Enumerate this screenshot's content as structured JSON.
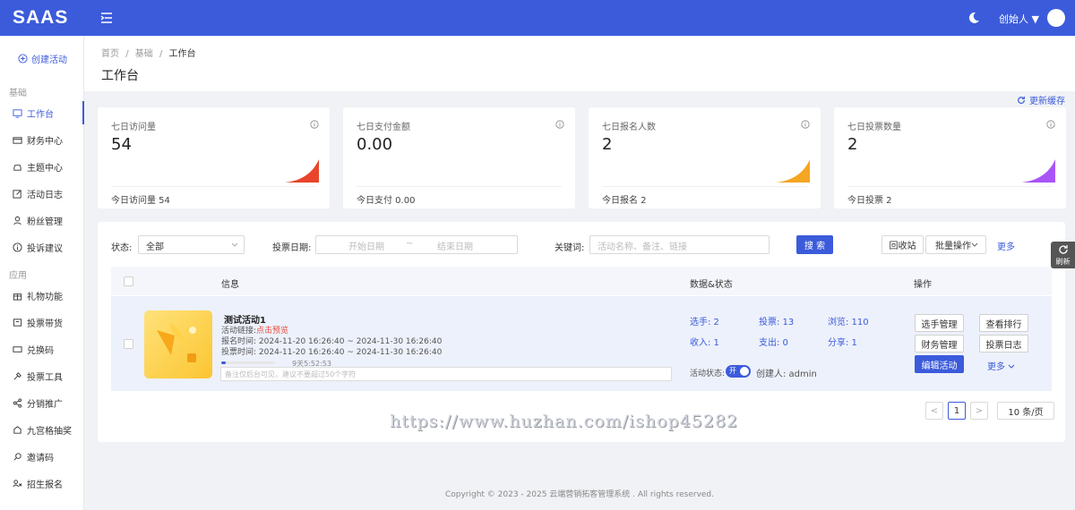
{
  "topbar": {
    "logo": "SAAS",
    "user": "创始人 ▼"
  },
  "sidebar": {
    "create": "创建活动",
    "group_basic": "基础",
    "group_app": "应用",
    "items": [
      {
        "label": "工作台",
        "icon": "monitor-icon"
      },
      {
        "label": "财务中心",
        "icon": "wallet-icon"
      },
      {
        "label": "主题中心",
        "icon": "car-icon"
      },
      {
        "label": "活动日志",
        "icon": "edit-icon"
      },
      {
        "label": "粉丝管理",
        "icon": "user-icon"
      },
      {
        "label": "投诉建议",
        "icon": "info-icon"
      },
      {
        "label": "礼物功能",
        "icon": "gift-icon"
      },
      {
        "label": "投票带货",
        "icon": "cart-icon"
      },
      {
        "label": "兑换码",
        "icon": "ticket-icon"
      },
      {
        "label": "投票工具",
        "icon": "tool-icon"
      },
      {
        "label": "分销推广",
        "icon": "share-icon"
      },
      {
        "label": "九宫格抽奖",
        "icon": "grid-icon"
      },
      {
        "label": "邀请码",
        "icon": "key-icon"
      },
      {
        "label": "招生报名",
        "icon": "people-icon"
      }
    ]
  },
  "breadcrumb": {
    "home": "首页",
    "sep": "/",
    "basic": "基础",
    "current": "工作台"
  },
  "page_title": "工作台",
  "refresh_cache": "更新缓存",
  "cards": [
    {
      "title": "七日访问量",
      "value": "54",
      "footer": "今日访问量 54",
      "color": "#e8452c"
    },
    {
      "title": "七日支付金额",
      "value": "0.00",
      "footer": "今日支付 0.00",
      "color": "#3b5bdb"
    },
    {
      "title": "七日报名人数",
      "value": "2",
      "footer": "今日报名 2",
      "color": "#f5a623"
    },
    {
      "title": "七日投票数量",
      "value": "2",
      "footer": "今日投票 2",
      "color": "#a855f7"
    }
  ],
  "filters": {
    "status_label": "状态:",
    "status_value": "全部",
    "date_label": "投票日期:",
    "start_placeholder": "开始日期",
    "date_sep": "~",
    "end_placeholder": "结束日期",
    "keyword_label": "关键词:",
    "keyword_placeholder": "活动名称、备注、链接",
    "search": "搜 索",
    "recycle": "回收站",
    "batch": "批量操作",
    "more": "更多"
  },
  "table": {
    "col_info": "信息",
    "col_stats": "数据&状态",
    "col_ops": "操作",
    "row": {
      "title": "测试活动1",
      "link_label": "活动链接:",
      "link_text": "点击预览",
      "signup_time": "报名时间: 2024-11-20 16:26:40 ~ 2024-11-30 16:26:40",
      "vote_time": "投票时间: 2024-11-20 16:26:40 ~ 2024-11-30 16:26:40",
      "countdown": "9天5:52:53",
      "progress": 0.08,
      "note_placeholder": "备注仅后台可见，建议不要超过50个字符",
      "players": "选手: 2",
      "votes": "投票: 13",
      "views": "浏览: 110",
      "income": "收入: 1",
      "expense": "支出: 0",
      "shares": "分享: 1",
      "status_label": "活动状态:",
      "toggle": "开",
      "creator": "创建人: admin",
      "ops": {
        "players": "选手管理",
        "rank": "查看排行",
        "finance": "财务管理",
        "vote_log": "投票日志",
        "edit": "编辑活动",
        "more": "更多"
      }
    }
  },
  "pagination": {
    "prev": "<",
    "current": "1",
    "next": ">",
    "size": "10 条/页"
  },
  "watermark": "https://www.huzhan.com/ishop45282",
  "side_refresh": "刷新",
  "footer": "Copyright © 2023 - 2025 云端营销拓客管理系统 . All rights reserved."
}
